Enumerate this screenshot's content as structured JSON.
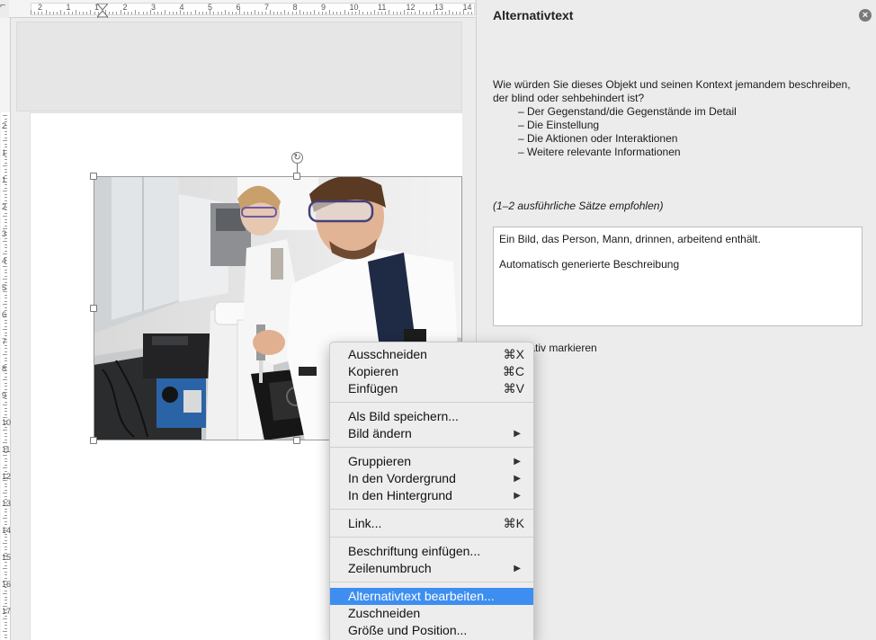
{
  "ruler": {
    "corner": "⌐",
    "h_numbers": [
      "2",
      "1",
      "1",
      "2",
      "3",
      "4",
      "5",
      "6",
      "7",
      "8",
      "9",
      "10",
      "11",
      "12",
      "13",
      "14"
    ],
    "v_numbers": [
      "2",
      "1",
      "1",
      "2",
      "3",
      "4",
      "5",
      "6",
      "7",
      "8",
      "9",
      "10",
      "11",
      "12",
      "13",
      "14",
      "15",
      "16",
      "17"
    ]
  },
  "document": {
    "image_icon": "photo-lab-researchers",
    "rotate_icon": "↻"
  },
  "context_menu": {
    "groups": [
      [
        {
          "label": "Ausschneiden",
          "shortcut": "⌘X"
        },
        {
          "label": "Kopieren",
          "shortcut": "⌘C"
        },
        {
          "label": "Einfügen",
          "shortcut": "⌘V"
        }
      ],
      [
        {
          "label": "Als Bild speichern...",
          "shortcut": ""
        },
        {
          "label": "Bild ändern",
          "submenu": true
        }
      ],
      [
        {
          "label": "Gruppieren",
          "submenu": true
        },
        {
          "label": "In den Vordergrund",
          "submenu": true
        },
        {
          "label": "In den Hintergrund",
          "submenu": true
        }
      ],
      [
        {
          "label": "Link...",
          "shortcut": "⌘K"
        }
      ],
      [
        {
          "label": "Beschriftung einfügen...",
          "shortcut": ""
        },
        {
          "label": "Zeilenumbruch",
          "submenu": true
        }
      ],
      [
        {
          "label": "Alternativtext bearbeiten...",
          "highlighted": true
        },
        {
          "label": "Zuschneiden"
        },
        {
          "label": "Größe und Position..."
        }
      ]
    ],
    "submenu_glyph": "▶",
    "highlight_color": "#3d8ef0"
  },
  "pane": {
    "title": "Alternativtext",
    "close_icon": "×",
    "intro": "Wie würden Sie dieses Objekt und seinen Kontext jemandem beschreiben, der blind oder sehbehindert ist?",
    "bullets": [
      "– Der Gegenstand/die Gegenstände im Detail",
      "– Die Einstellung",
      "– Die Aktionen oder Interaktionen",
      "– Weitere relevante Informationen"
    ],
    "hint": "(1–2 ausführliche Sätze empfohlen)",
    "alt_text_line1": "Ein Bild, das Person, Mann, drinnen, arbeitend enthält.",
    "alt_text_line2": "Automatisch generierte Beschreibung",
    "decorative_label": "ekorativ markieren"
  }
}
